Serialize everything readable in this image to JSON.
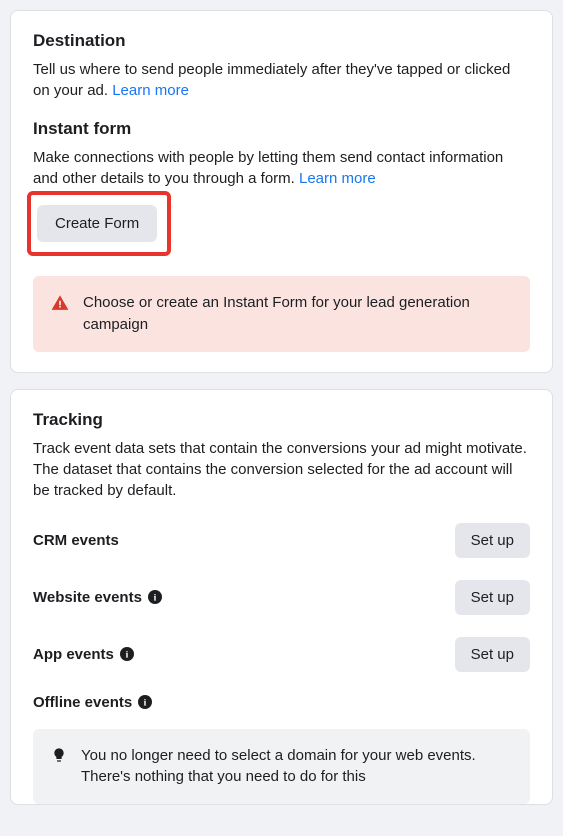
{
  "destination": {
    "title": "Destination",
    "desc": "Tell us where to send people immediately after they've tapped or clicked on your ad. ",
    "learn_more": "Learn more"
  },
  "instant_form": {
    "title": "Instant form",
    "desc": "Make connections with people by letting them send contact information and other details to you through a form. ",
    "learn_more": "Learn more",
    "create_button": "Create Form",
    "alert": "Choose or create an Instant Form for your lead generation campaign"
  },
  "tracking": {
    "title": "Tracking",
    "desc": "Track event data sets that contain the conversions your ad might motivate. The dataset that contains the conversion selected for the ad account will be tracked by default.",
    "rows": [
      {
        "label": "CRM events",
        "button": "Set up",
        "info": false
      },
      {
        "label": "Website events",
        "button": "Set up",
        "info": true
      },
      {
        "label": "App events",
        "button": "Set up",
        "info": true
      }
    ],
    "offline": {
      "label": "Offline events",
      "info": true
    },
    "hint": "You no longer need to select a domain for your web events. There's nothing that you need to do for this"
  }
}
